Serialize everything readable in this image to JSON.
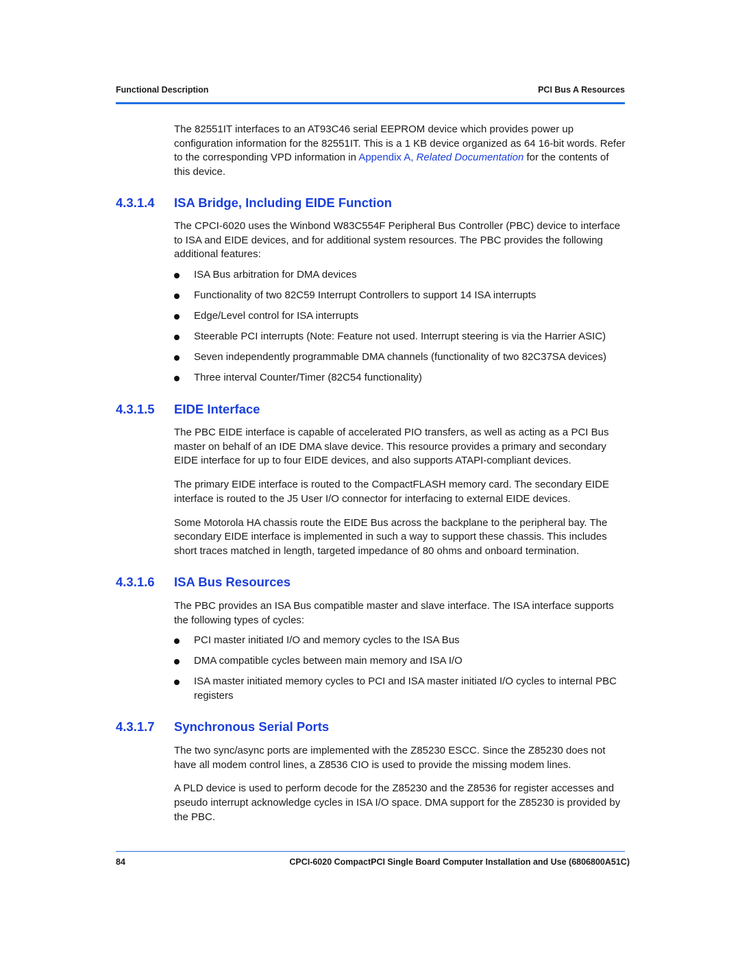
{
  "header": {
    "left": "Functional Description",
    "right": "PCI Bus A Resources"
  },
  "intro": {
    "part1": "The 82551IT interfaces to an AT93C46 serial EEPROM device which provides power up configuration information for the 82551IT. This is a 1 KB device organized as 64 16-bit words. Refer to the corresponding VPD information in ",
    "link1": "Appendix A, ",
    "link2": "Related Documentation",
    "part2": " for the contents of this device."
  },
  "sections": [
    {
      "number": "4.3.1.4",
      "title": "ISA Bridge, Including EIDE Function",
      "paragraphs": [
        "The CPCI-6020 uses the Winbond W83C554F Peripheral Bus Controller (PBC) device to interface to ISA and EIDE devices, and for additional system resources. The PBC provides the following additional features:"
      ],
      "bullets": [
        "ISA Bus arbitration for DMA devices",
        "Functionality of two 82C59 Interrupt Controllers to support 14 ISA interrupts",
        "Edge/Level control for ISA interrupts",
        "Steerable PCI interrupts (Note: Feature not used. Interrupt steering is via the Harrier ASIC)",
        "Seven independently programmable DMA channels (functionality of two 82C37SA devices)",
        "Three interval Counter/Timer (82C54 functionality)"
      ]
    },
    {
      "number": "4.3.1.5",
      "title": "EIDE Interface",
      "paragraphs": [
        "The PBC EIDE interface is capable of accelerated PIO transfers, as well as acting as a PCI Bus master on behalf of an IDE DMA slave device. This resource provides a primary and secondary EIDE interface for up to four EIDE devices, and also supports ATAPI-compliant devices.",
        "The primary EIDE interface is routed to the CompactFLASH memory card. The secondary EIDE interface is routed to the J5 User I/O connector for interfacing to external EIDE devices.",
        "Some Motorola HA chassis route the EIDE Bus across the backplane to the peripheral bay. The secondary EIDE interface is implemented in such a way to support these chassis. This includes short traces matched in length, targeted impedance of 80 ohms and onboard termination."
      ]
    },
    {
      "number": "4.3.1.6",
      "title": "ISA Bus Resources",
      "paragraphs": [
        "The PBC provides an ISA Bus compatible master and slave interface. The ISA interface supports the following types of cycles:"
      ],
      "bullets": [
        "PCI master initiated I/O and memory cycles to the ISA Bus",
        "DMA compatible cycles between main memory and ISA I/O",
        "ISA master initiated memory cycles to PCI and ISA master initiated I/O cycles to internal PBC registers"
      ]
    },
    {
      "number": "4.3.1.7",
      "title": "Synchronous Serial Ports",
      "paragraphs": [
        "The two sync/async ports are implemented with the Z85230 ESCC. Since the Z85230 does not have all modem control lines, a Z8536 CIO is used to provide the missing modem lines.",
        "A PLD device is used to perform decode for the Z85230 and the Z8536 for register accesses and pseudo interrupt acknowledge cycles in ISA I/O space. DMA support for the Z85230 is provided by the PBC."
      ]
    }
  ],
  "footer": {
    "page_number": "84",
    "title": "CPCI-6020 CompactPCI Single Board Computer Installation and Use (6806800A51C)"
  }
}
